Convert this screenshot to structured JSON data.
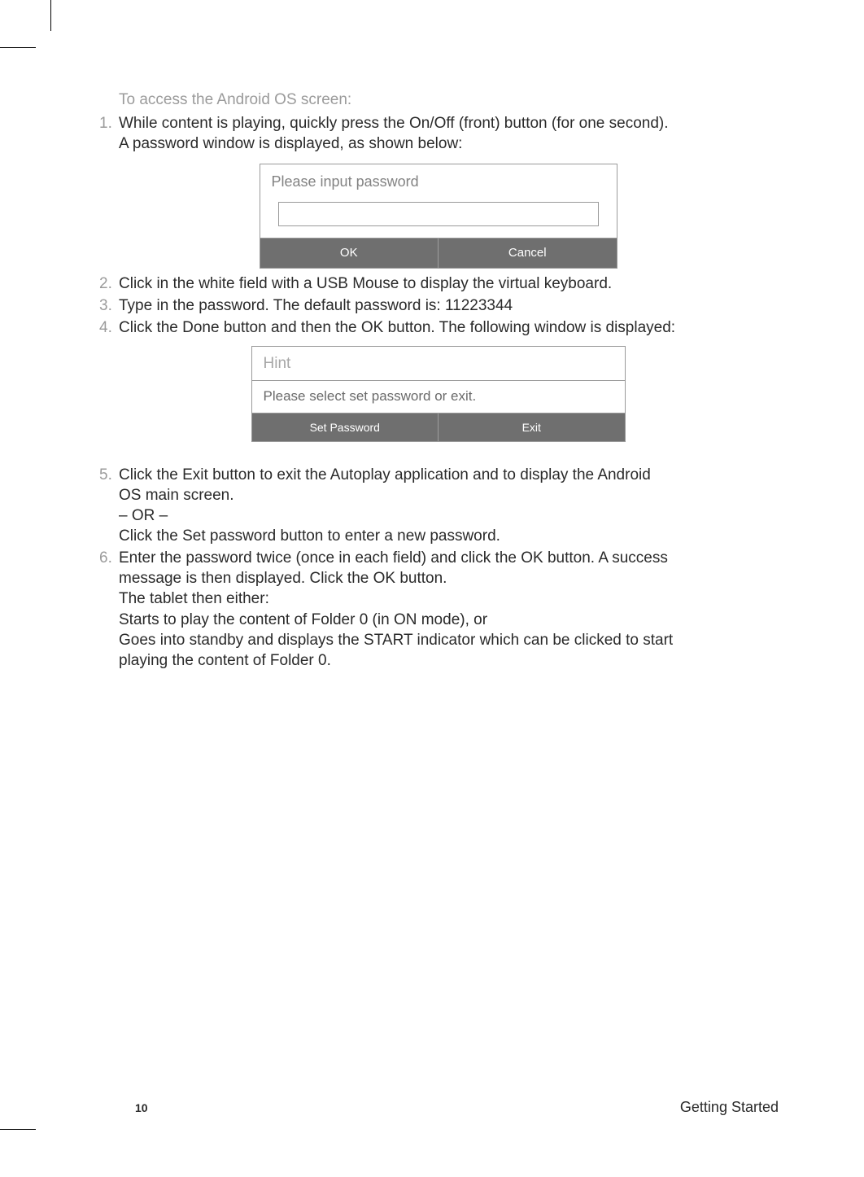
{
  "heading": "To access the Android OS screen:",
  "steps": {
    "s1_num": "1.",
    "s1_line1": "While content is playing, quickly press the On/Off (front)  button (for one second).",
    "s1_line2": "A password window is displayed, as shown below:",
    "s2_num": "2.",
    "s2_text": "Click in the white field with a USB Mouse to display the virtual keyboard.",
    "s3_num": "3.",
    "s3_text": "Type in the password. The default password is: 11223344",
    "s4_num": "4.",
    "s4_text": "Click the Done button and then the OK button. The following window is displayed:",
    "s5_num": "5.",
    "s5_line1": "Click the Exit button to exit the Autoplay application and to display the Android",
    "s5_line2": "OS main screen.",
    "s5_line3": "– OR –",
    "s5_line4": "Click the Set password button to enter a new password.",
    "s6_num": "6.",
    "s6_line1": "Enter the password twice (once in each field) and click the OK button. A success",
    "s6_line2": "message is then displayed. Click the OK button.",
    "s6_line3": "The tablet then either:",
    "s6_line4": "Starts to play the content of Folder 0 (in ON mode), or",
    "s6_line5": "Goes into standby and displays the START indicator which can be clicked to start",
    "s6_line6": "playing the content of Folder 0."
  },
  "dialog1": {
    "title": "Please input password",
    "ok": "OK",
    "cancel": "Cancel"
  },
  "dialog2": {
    "title": "Hint",
    "message": "Please select set password or exit.",
    "set_password": "Set Password",
    "exit": "Exit"
  },
  "footer": {
    "page": "10",
    "section": "Getting Started"
  }
}
